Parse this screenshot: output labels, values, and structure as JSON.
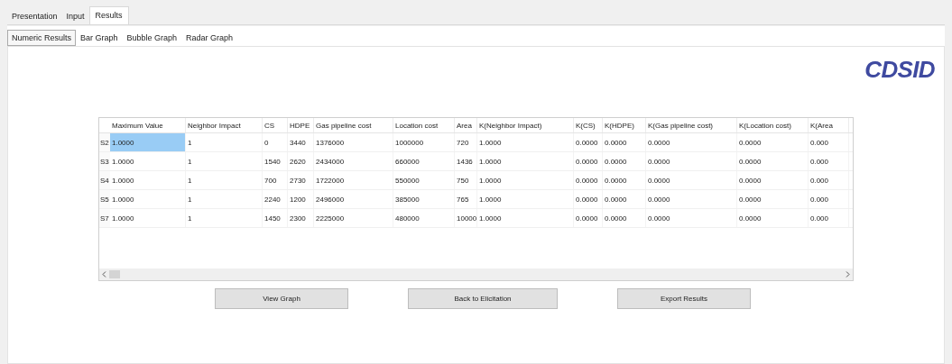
{
  "tabs": [
    {
      "label": "Presentation",
      "selected": false
    },
    {
      "label": "Input",
      "selected": false
    },
    {
      "label": "Results",
      "selected": true
    }
  ],
  "subtabs": [
    {
      "label": "Numeric Results",
      "selected": true
    },
    {
      "label": "Bar Graph",
      "selected": false
    },
    {
      "label": "Bubble Graph",
      "selected": false
    },
    {
      "label": "Radar Graph",
      "selected": false
    }
  ],
  "logo": {
    "text": "CDSID"
  },
  "table": {
    "columns": [
      "Maximum Value",
      "Neighbor Impact",
      "CS",
      "HDPE",
      "Gas pipeline cost",
      "Location cost",
      "Area",
      "K(Neighbor Impact)",
      "K(CS)",
      "K(HDPE)",
      "K(Gas pipeline cost)",
      "K(Location cost)",
      "K(Area"
    ],
    "rows": [
      {
        "label": "S2",
        "cells": [
          {
            "text": "1.0000",
            "selected": true
          },
          {
            "text": "1",
            "selected": false
          },
          {
            "text": "0",
            "selected": false
          },
          {
            "text": "3440",
            "selected": false
          },
          {
            "text": "1376000",
            "selected": false
          },
          {
            "text": "1000000",
            "selected": false
          },
          {
            "text": "720",
            "selected": false
          },
          {
            "text": "1.0000",
            "selected": false
          },
          {
            "text": "0.0000",
            "selected": false
          },
          {
            "text": "0.0000",
            "selected": false
          },
          {
            "text": "0.0000",
            "selected": false
          },
          {
            "text": "0.0000",
            "selected": false
          },
          {
            "text": "0.000",
            "selected": false
          }
        ]
      },
      {
        "label": "S3",
        "cells": [
          {
            "text": "1.0000",
            "selected": false
          },
          {
            "text": "1",
            "selected": false
          },
          {
            "text": "1540",
            "selected": false
          },
          {
            "text": "2620",
            "selected": false
          },
          {
            "text": "2434000",
            "selected": false
          },
          {
            "text": "660000",
            "selected": false
          },
          {
            "text": "1436",
            "selected": false
          },
          {
            "text": "1.0000",
            "selected": false
          },
          {
            "text": "0.0000",
            "selected": false
          },
          {
            "text": "0.0000",
            "selected": false
          },
          {
            "text": "0.0000",
            "selected": false
          },
          {
            "text": "0.0000",
            "selected": false
          },
          {
            "text": "0.000",
            "selected": false
          }
        ]
      },
      {
        "label": "S4",
        "cells": [
          {
            "text": "1.0000",
            "selected": false
          },
          {
            "text": "1",
            "selected": false
          },
          {
            "text": "700",
            "selected": false
          },
          {
            "text": "2730",
            "selected": false
          },
          {
            "text": "1722000",
            "selected": false
          },
          {
            "text": "550000",
            "selected": false
          },
          {
            "text": "750",
            "selected": false
          },
          {
            "text": "1.0000",
            "selected": false
          },
          {
            "text": "0.0000",
            "selected": false
          },
          {
            "text": "0.0000",
            "selected": false
          },
          {
            "text": "0.0000",
            "selected": false
          },
          {
            "text": "0.0000",
            "selected": false
          },
          {
            "text": "0.000",
            "selected": false
          }
        ]
      },
      {
        "label": "S5",
        "cells": [
          {
            "text": "1.0000",
            "selected": false
          },
          {
            "text": "1",
            "selected": false
          },
          {
            "text": "2240",
            "selected": false
          },
          {
            "text": "1200",
            "selected": false
          },
          {
            "text": "2496000",
            "selected": false
          },
          {
            "text": "385000",
            "selected": false
          },
          {
            "text": "765",
            "selected": false
          },
          {
            "text": "1.0000",
            "selected": false
          },
          {
            "text": "0.0000",
            "selected": false
          },
          {
            "text": "0.0000",
            "selected": false
          },
          {
            "text": "0.0000",
            "selected": false
          },
          {
            "text": "0.0000",
            "selected": false
          },
          {
            "text": "0.000",
            "selected": false
          }
        ]
      },
      {
        "label": "S7",
        "cells": [
          {
            "text": "1.0000",
            "selected": false
          },
          {
            "text": "1",
            "selected": false
          },
          {
            "text": "1450",
            "selected": false
          },
          {
            "text": "2300",
            "selected": false
          },
          {
            "text": "2225000",
            "selected": false
          },
          {
            "text": "480000",
            "selected": false
          },
          {
            "text": "10000",
            "selected": false
          },
          {
            "text": "1.0000",
            "selected": false
          },
          {
            "text": "0.0000",
            "selected": false
          },
          {
            "text": "0.0000",
            "selected": false
          },
          {
            "text": "0.0000",
            "selected": false
          },
          {
            "text": "0.0000",
            "selected": false
          },
          {
            "text": "0.000",
            "selected": false
          }
        ]
      }
    ]
  },
  "buttons": [
    "View Graph",
    "Back to Elicitation",
    "Export Results"
  ]
}
